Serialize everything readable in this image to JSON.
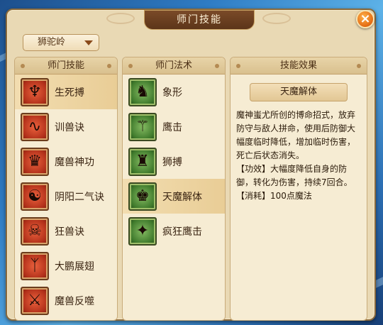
{
  "window": {
    "title": "师门技能",
    "close_label": "×"
  },
  "school_dropdown": {
    "selected": "狮驼岭"
  },
  "skills_panel": {
    "header": "师门技能",
    "items": [
      {
        "label": "生死搏",
        "icon": "bloody-claw-icon",
        "selected": true
      },
      {
        "label": "训兽诀",
        "icon": "whip-icon",
        "selected": false
      },
      {
        "label": "魔兽神功",
        "icon": "demon-crown-icon",
        "selected": false
      },
      {
        "label": "阴阳二气诀",
        "icon": "yin-yang-mask-icon",
        "selected": false
      },
      {
        "label": "狂兽诀",
        "icon": "beast-skull-icon",
        "selected": false
      },
      {
        "label": "大鹏展翅",
        "icon": "roc-wings-icon",
        "selected": false
      },
      {
        "label": "魔兽反噬",
        "icon": "demon-bite-icon",
        "selected": false
      }
    ]
  },
  "spells_panel": {
    "header": "师门法术",
    "items": [
      {
        "label": "象形",
        "icon": "elephant-icon",
        "selected": false
      },
      {
        "label": "鹰击",
        "icon": "eagle-strike-icon",
        "selected": false
      },
      {
        "label": "狮搏",
        "icon": "lion-strike-icon",
        "selected": false
      },
      {
        "label": "天魔解体",
        "icon": "demon-release-icon",
        "selected": true
      },
      {
        "label": "疯狂鹰击",
        "icon": "frenzy-eagle-icon",
        "selected": false
      }
    ]
  },
  "effect_panel": {
    "header": "技能效果",
    "skill_name": "天魔解体",
    "description": "魔神蚩尤所创的博命招式，放弃防守与敌人拼命，使用后防御大幅度临时降低，增加临时伤害，死亡后状态消失。",
    "effect": "【功效】大幅度降低自身的防御，转化为伤害，持续7回合。",
    "cost": "【消耗】100点魔法"
  },
  "colors": {
    "window_bg": "#e9d9b4",
    "selected_bg": "#e9cd96",
    "title_bar": "#5c3519",
    "close_button": "#e36a12"
  }
}
